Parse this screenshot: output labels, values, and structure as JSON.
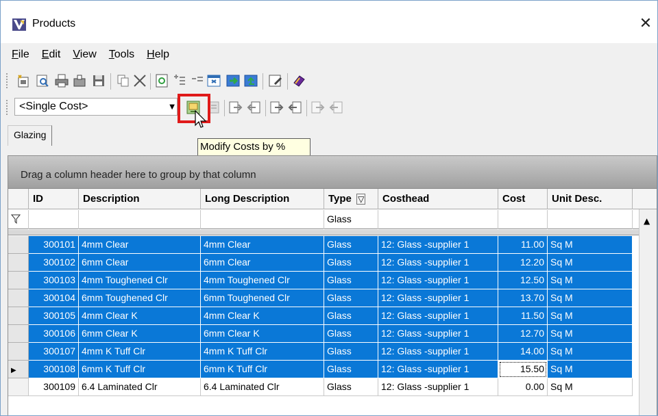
{
  "window": {
    "title": "Products"
  },
  "menu": [
    {
      "pre": "",
      "u": "F",
      "post": "ile"
    },
    {
      "pre": "",
      "u": "E",
      "post": "dit"
    },
    {
      "pre": "",
      "u": "V",
      "post": "iew"
    },
    {
      "pre": "",
      "u": "T",
      "post": "ools"
    },
    {
      "pre": "",
      "u": "H",
      "post": "elp"
    }
  ],
  "toolbar2": {
    "cost_select_value": "<Single Cost>"
  },
  "tooltip": "Modify Costs by %",
  "tabs": [
    "Glazing"
  ],
  "grid": {
    "group_hint": "Drag a column header here to group by that column",
    "columns": [
      "ID",
      "Description",
      "Long Description",
      "Type",
      "Costhead",
      "Cost",
      "Unit Desc."
    ],
    "filter": {
      "type": "Glass"
    },
    "rows": [
      {
        "id": "300101",
        "desc": "4mm Clear",
        "long": "4mm Clear",
        "type": "Glass",
        "costhead": "12: Glass -supplier 1",
        "cost": "11.00",
        "unit": "Sq M",
        "selected": true
      },
      {
        "id": "300102",
        "desc": "6mm Clear",
        "long": "6mm Clear",
        "type": "Glass",
        "costhead": "12: Glass -supplier 1",
        "cost": "12.20",
        "unit": "Sq M",
        "selected": true
      },
      {
        "id": "300103",
        "desc": "4mm Toughened Clr",
        "long": "4mm Toughened Clr",
        "type": "Glass",
        "costhead": "12: Glass -supplier 1",
        "cost": "12.50",
        "unit": "Sq M",
        "selected": true
      },
      {
        "id": "300104",
        "desc": "6mm Toughened Clr",
        "long": "6mm Toughened Clr",
        "type": "Glass",
        "costhead": "12: Glass -supplier 1",
        "cost": "13.70",
        "unit": "Sq M",
        "selected": true
      },
      {
        "id": "300105",
        "desc": "4mm Clear K",
        "long": "4mm Clear K",
        "type": "Glass",
        "costhead": "12: Glass -supplier 1",
        "cost": "11.50",
        "unit": "Sq M",
        "selected": true
      },
      {
        "id": "300106",
        "desc": "6mm Clear K",
        "long": "6mm Clear K",
        "type": "Glass",
        "costhead": "12: Glass -supplier 1",
        "cost": "12.70",
        "unit": "Sq M",
        "selected": true
      },
      {
        "id": "300107",
        "desc": "4mm K Tuff Clr",
        "long": "4mm K Tuff Clr",
        "type": "Glass",
        "costhead": "12: Glass -supplier 1",
        "cost": "14.00",
        "unit": "Sq M",
        "selected": true
      },
      {
        "id": "300108",
        "desc": "6mm K Tuff Clr",
        "long": "6mm K Tuff Clr",
        "type": "Glass",
        "costhead": "12: Glass -supplier 1",
        "cost": "15.50",
        "unit": "Sq M",
        "selected": true,
        "current": true
      },
      {
        "id": "300109",
        "desc": "6.4 Laminated Clr",
        "long": "6.4 Laminated Clr",
        "type": "Glass",
        "costhead": "12: Glass -supplier 1",
        "cost": "0.00",
        "unit": "Sq M",
        "selected": false
      }
    ]
  },
  "colors": {
    "selection": "#0a78d7",
    "highlight_box": "#e01a1a",
    "tooltip_bg": "#ffffe1"
  }
}
